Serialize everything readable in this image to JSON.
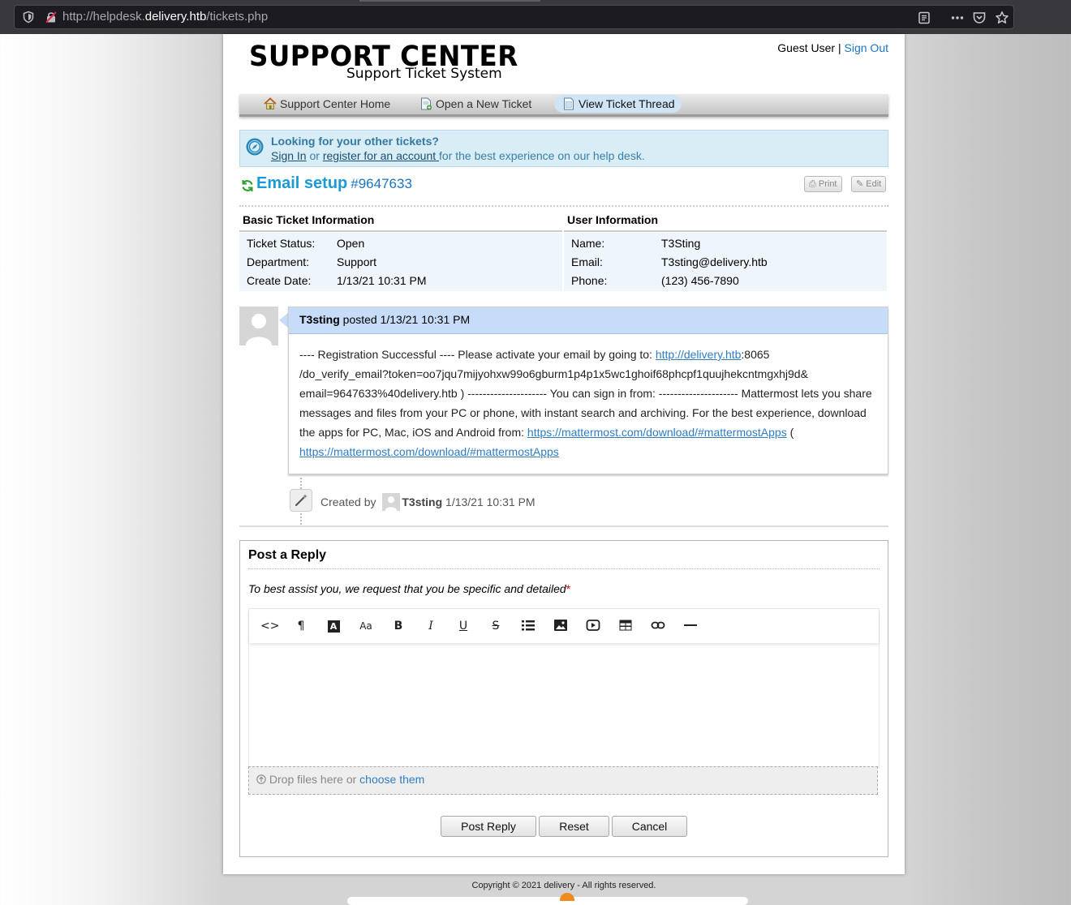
{
  "browser": {
    "url_prefix": "http://helpdesk.",
    "url_host": "delivery.htb",
    "url_path": "/tickets.php"
  },
  "header": {
    "logo_title": "SUPPORT CENTER",
    "logo_subtitle": "Support Ticket System",
    "user_name": "Guest User",
    "separator": "|",
    "sign_out": "Sign Out"
  },
  "nav": {
    "items": [
      {
        "label": "Support Center Home",
        "icon": "home-icon"
      },
      {
        "label": "Open a New Ticket",
        "icon": "new-ticket-icon"
      },
      {
        "label": "View Ticket Thread",
        "icon": "ticket-thread-icon"
      }
    ]
  },
  "notice": {
    "title": "Looking for your other tickets?",
    "sign_in": "Sign In",
    "or": " or ",
    "register": "register for an account ",
    "rest": "for the best experience on our help desk."
  },
  "ticket": {
    "subject": "Email setup",
    "number": "#9647633",
    "print_label": "Print",
    "edit_label": "Edit"
  },
  "basic_info": {
    "header": "Basic Ticket Information",
    "rows": [
      {
        "key": "Ticket Status:",
        "value": "Open"
      },
      {
        "key": "Department:",
        "value": "Support"
      },
      {
        "key": "Create Date:",
        "value": "1/13/21 10:31 PM"
      }
    ]
  },
  "user_info": {
    "header": "User Information",
    "rows": [
      {
        "key": "Name:",
        "value": "T3Sting"
      },
      {
        "key": "Email:",
        "value": "T3sting@delivery.htb"
      },
      {
        "key": "Phone:",
        "value": "(123) 456-7890"
      }
    ]
  },
  "thread": {
    "author": "T3sting",
    "posted": " posted 1/13/21 10:31 PM",
    "line1_pre": "---- Registration Successful ---- Please activate your email by going to: ",
    "line1_link": "http://delivery.htb",
    "line1_post": ":8065",
    "line2": "/do_verify_email?token=oo7jqu7mijyohxw99o6gburm1p4p1x5wc1ghoif68phcpf1quujhekcntmgxhj9d&",
    "line3": "email=9647633%40delivery.htb ) --------------------- You can sign in from: --------------------- Mattermost lets you share",
    "line4": "messages and files from your PC or phone, with instant search and archiving. For the best experience, download",
    "line5_pre": "the apps for PC, Mac, iOS and Android from: ",
    "line5_link": "https://mattermost.com/download/#mattermostApps",
    "line5_post": " (",
    "line6_link": "https://mattermost.com/download/#mattermostApps"
  },
  "event": {
    "created_by": "Created by",
    "author": "T3sting",
    "timestamp": " 1/13/21 10:31 PM"
  },
  "reply": {
    "title": "Post a Reply",
    "hint": "To best assist you, we request that you be specific and detailed",
    "required_mark": "*",
    "toolbar": [
      "code-view-icon",
      "paragraph-icon",
      "font-color-icon",
      "font-size-icon",
      "bold-icon",
      "italic-icon",
      "underline-icon",
      "strikethrough-icon",
      "list-icon",
      "image-icon",
      "video-icon",
      "table-icon",
      "link-icon",
      "horizontal-rule-icon"
    ],
    "drop_text": "Drop files here or ",
    "choose": "choose them",
    "post_button": "Post Reply",
    "reset_button": "Reset",
    "cancel_button": "Cancel"
  },
  "footer": {
    "copyright": "Copyright © 2021 delivery - All rights reserved."
  }
}
